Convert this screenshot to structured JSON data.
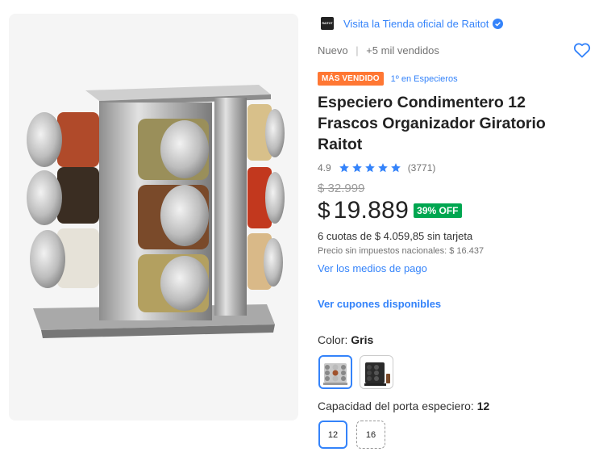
{
  "store": {
    "logo_text": "RAITOT",
    "link_text": "Visita la Tienda oficial de Raitot"
  },
  "meta": {
    "condition": "Nuevo",
    "separator": "|",
    "sold": "+5 mil vendidos"
  },
  "badges": {
    "best_seller": "MÁS VENDIDO",
    "rank": "1º en Especieros"
  },
  "product": {
    "title": "Especiero Condimentero 12 Frascos Organizador Giratorio Raitot"
  },
  "rating": {
    "score": "4.9",
    "stars": 4.9,
    "stars_max": 5,
    "count": "(3771)"
  },
  "pricing": {
    "old_price": "$ 32.999",
    "currency": "$",
    "price": "19.889",
    "discount": "39% OFF",
    "installments": "6 cuotas de $ 4.059,85 sin tarjeta",
    "no_tax": "Precio sin impuestos nacionales: $ 16.437",
    "payment_link": "Ver los medios de pago"
  },
  "coupons": {
    "link": "Ver cupones disponibles"
  },
  "color": {
    "label": "Color: ",
    "selected": "Gris"
  },
  "capacity": {
    "label": "Capacidad del porta especiero: ",
    "selected": "12",
    "options": [
      "12",
      "16"
    ]
  },
  "colors": {
    "link_blue": "#3483fa",
    "badge_orange": "#ff7733",
    "discount_green": "#00a650"
  }
}
